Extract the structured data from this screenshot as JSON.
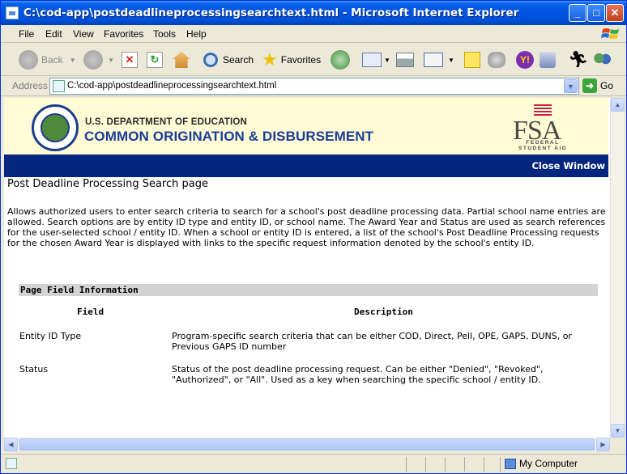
{
  "window": {
    "title": "C:\\cod-app\\postdeadlineprocessingsearchtext.html - Microsoft Internet Explorer",
    "min_glyph": "_",
    "max_glyph": "□",
    "close_glyph": "✕"
  },
  "menu": {
    "items": [
      "File",
      "Edit",
      "View",
      "Favorites",
      "Tools",
      "Help"
    ]
  },
  "toolbar": {
    "back_label": "Back",
    "search_label": "Search",
    "favorites_label": "Favorites"
  },
  "address": {
    "label": "Address",
    "value": "C:\\cod-app\\postdeadlineprocessingsearchtext.html",
    "go_label": "Go"
  },
  "banner": {
    "dept": "U.S. DEPARTMENT OF EDUCATION",
    "app_name": "COMMON ORIGINATION & DISBURSEMENT",
    "fsa_letters": "FSA",
    "fsa_sub": "FEDERAL STUDENT AID",
    "close_window": "Close Window"
  },
  "page": {
    "heading": "Post Deadline Processing Search page",
    "intro": "Allows authorized users to enter search criteria to search for a school's post deadline processing data. Partial school name entries are allowed. Search options are by entity ID type and entity ID, or school name. The Award Year and Status are used as search references for the user-selected school / entity ID. When a school or entity ID is entered, a list of the school's Post Deadline Processing requests for the chosen Award Year is displayed with links to the specific request information denoted by the school's entity ID.",
    "section_title": "Page Field Information",
    "col_field": "Field",
    "col_description": "Description",
    "rows": [
      {
        "field": "Entity ID Type",
        "description": "Program-specific search criteria that can be either COD, Direct, Pell, OPE, GAPS, DUNS, or Previous GAPS ID number"
      },
      {
        "field": "Status",
        "description": "Status of the post deadline processing request. Can be either \"Denied\", \"Revoked\", \"Authorized\", or \"All\". Used as a key when searching the specific school / entity ID."
      }
    ]
  },
  "status": {
    "zone": "My Computer"
  }
}
